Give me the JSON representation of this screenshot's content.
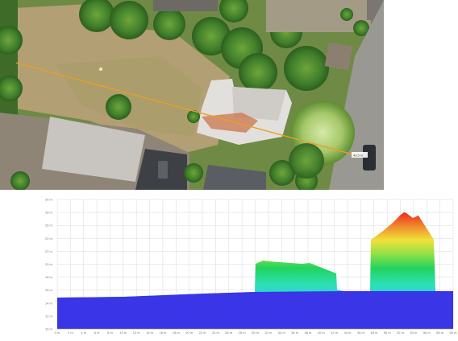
{
  "aerial": {
    "measurement_label": "43.5 m"
  },
  "profile": {
    "y_ticks": [
      "30 m",
      "28 m",
      "26 m",
      "24 m",
      "22 m",
      "20 m",
      "18 m",
      "16 m",
      "14 m",
      "12 m",
      "10 m"
    ],
    "x_ticks": [
      "0 m",
      "2 m",
      "4 m",
      "6 m",
      "8 m",
      "10 m",
      "12 m",
      "14 m",
      "16 m",
      "18 m",
      "20 m",
      "22 m",
      "24 m",
      "26 m",
      "28 m",
      "30 m",
      "32 m",
      "34 m",
      "36 m",
      "38 m",
      "40 m",
      "42 m",
      "44 m",
      "46 m",
      "48 m",
      "50 m",
      "52 m",
      "54 m",
      "56 m",
      "58 m",
      "60 m"
    ]
  }
}
